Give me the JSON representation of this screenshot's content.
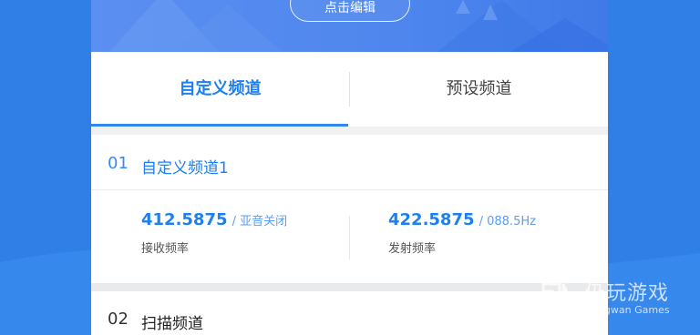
{
  "banner": {
    "edit_button_label": "点击编辑"
  },
  "tabs": [
    {
      "label": "自定义频道",
      "active": true
    },
    {
      "label": "预设频道",
      "active": false
    }
  ],
  "sections": [
    {
      "number": "01",
      "title": "自定义频道1"
    },
    {
      "number": "02",
      "title": "扫描频道"
    }
  ],
  "frequencies": {
    "receive": {
      "value": "412.5875",
      "sub": "/ 亚音关闭",
      "label": "接收频率"
    },
    "transmit": {
      "value": "422.5875",
      "sub": "/ 088.5Hz",
      "label": "发射频率"
    }
  },
  "watermark": {
    "cn": "仍玩游戏",
    "en": "Rengwan Games"
  },
  "colors": {
    "accent": "#1e7ff0",
    "background": "#2f7fe6",
    "banner": "#4e86ee"
  }
}
